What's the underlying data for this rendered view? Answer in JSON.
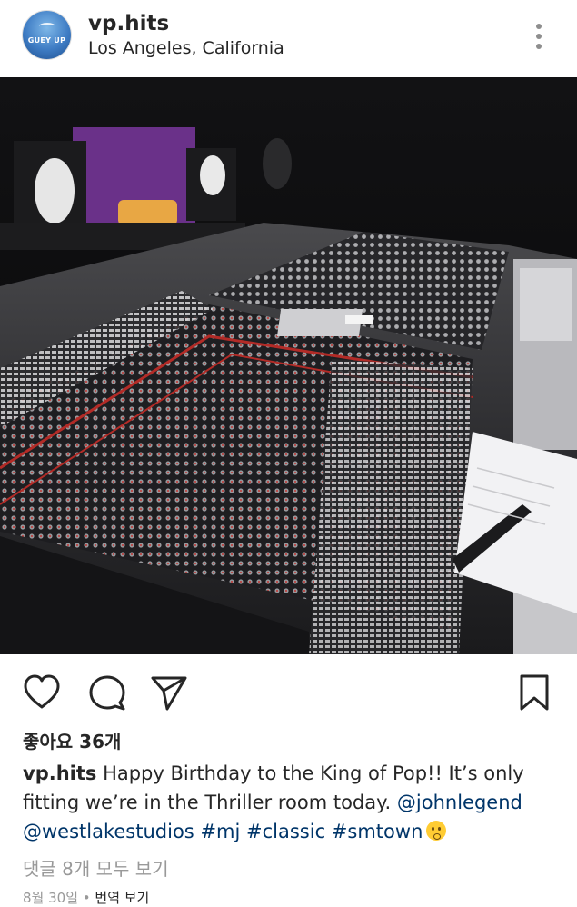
{
  "post": {
    "username": "vp.hits",
    "avatar_text": "GUEY UP",
    "location": "Los Angeles, California",
    "likes_text": "좋아요 36개",
    "caption": {
      "username": "vp.hits",
      "text": " Happy Birthday to the King of Pop!! It’s only fitting we’re in the Thriller room today. ",
      "mention_1": "@johnlegend",
      "mention_2": "@westlakestudios",
      "hashtag_1": "#mj",
      "hashtag_2": "#classic",
      "hashtag_3": "#smtown",
      "emoji": "shushing-face"
    },
    "comments_link": "댓글 8개 모두 보기",
    "date": "8월 30일",
    "separator": " • ",
    "translate": "번역 보기"
  },
  "icons": {
    "more": "more-vertical-icon",
    "like": "heart-icon",
    "comment": "comment-icon",
    "share": "paper-plane-icon",
    "save": "bookmark-icon"
  },
  "colors": {
    "text": "#262626",
    "link": "#003569",
    "secondary": "#999999"
  }
}
